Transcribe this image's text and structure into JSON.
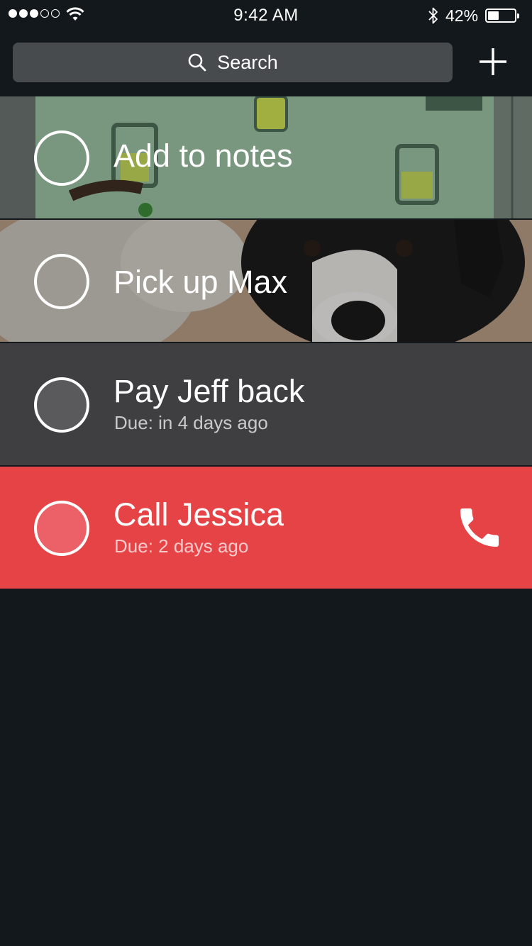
{
  "status_bar": {
    "time": "9:42 AM",
    "battery_percent": "42%",
    "battery_level": 0.42,
    "signal_bars_filled": 3,
    "signal_bars_total": 5,
    "icons": [
      "signal-dots-icon",
      "wifi-icon",
      "bluetooth-icon",
      "battery-icon"
    ]
  },
  "header": {
    "search_label": "Search",
    "icons": [
      "search-icon",
      "plus-icon"
    ]
  },
  "tasks": [
    {
      "title": "Add to notes",
      "due": "",
      "background": "whiteboard-photo",
      "check_fill": "transparent"
    },
    {
      "title": "Pick up Max",
      "due": "",
      "background": "dog-photo",
      "check_fill": "transparent"
    },
    {
      "title": "Pay Jeff back",
      "due": "Due: in 4 days ago",
      "background": "#3f3f41",
      "check_fill": "#5a5a5c"
    },
    {
      "title": "Call Jessica",
      "due": "Due: 2 days ago",
      "background": "#e64346",
      "check_fill": "#ec6167",
      "action_icon": "phone-icon"
    }
  ],
  "colors": {
    "app_background": "#12181b",
    "search_background": "#474b4e",
    "accent_red": "#e64346"
  }
}
